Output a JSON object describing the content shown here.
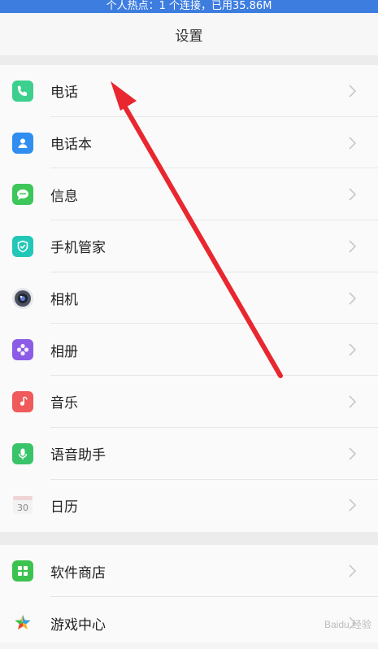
{
  "status_bar": {
    "text": "个人热点：1 个连接，已用35.86M"
  },
  "header": {
    "title": "设置"
  },
  "groups": [
    {
      "items": [
        {
          "label": "电话",
          "icon": "phone-icon",
          "color": "#3ccf8e"
        },
        {
          "label": "电话本",
          "icon": "contacts-icon",
          "color": "#2f8ef0"
        },
        {
          "label": "信息",
          "icon": "message-icon",
          "color": "#3dc75a"
        },
        {
          "label": "手机管家",
          "icon": "shield-icon",
          "color": "#22c7b8"
        },
        {
          "label": "相机",
          "icon": "camera-icon",
          "color": "#4a5060"
        },
        {
          "label": "相册",
          "icon": "gallery-icon",
          "color": "#8c5ce6"
        },
        {
          "label": "音乐",
          "icon": "music-icon",
          "color": "#f05a5a"
        },
        {
          "label": "语音助手",
          "icon": "microphone-icon",
          "color": "#39c46a"
        },
        {
          "label": "日历",
          "icon": "calendar-icon",
          "color": "#e9e9e9",
          "calendar_day": "30"
        }
      ]
    },
    {
      "items": [
        {
          "label": "软件商店",
          "icon": "app-store-icon",
          "color": "#3cc24f"
        },
        {
          "label": "游戏中心",
          "icon": "game-center-icon",
          "color": "#ffffff"
        }
      ]
    }
  ],
  "watermark": {
    "text": "Baidu 经验"
  },
  "annotation_arrow_color": "#e8272f"
}
